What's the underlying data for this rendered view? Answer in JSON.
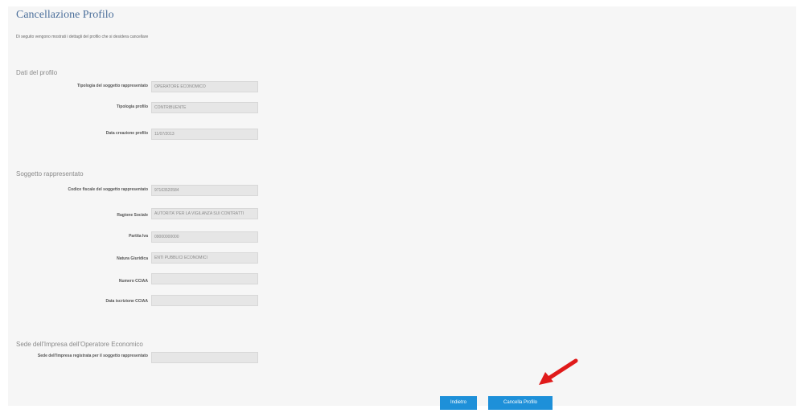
{
  "page": {
    "title": "Cancellazione Profilo",
    "intro": "Di seguito vengono mostrati i dettagli del profilo che si desidera cancellare"
  },
  "sections": [
    {
      "title": "Dati del profilo",
      "rows": [
        {
          "label": "Tipologia del soggetto rappresentato",
          "value": "OPERATORE ECONOMICO"
        },
        {
          "label": "Tipologia profilo",
          "value": "CONTRIBUENTE"
        },
        {
          "label": "Data creazione profilo",
          "value": "11/07/2013"
        }
      ]
    },
    {
      "title": "Soggetto rappresentato",
      "rows": [
        {
          "label": "Codice fiscale del soggetto rappresentato",
          "value": "97163520584"
        },
        {
          "label": "Ragione Sociale",
          "value": "AUTORITA' PER LA VIGILANZA SUI CONTRATTI"
        },
        {
          "label": "Partita Iva",
          "value": "09000000000"
        },
        {
          "label": "Natura Giuridica",
          "value": "ENTI PUBBLICI ECONOMICI"
        },
        {
          "label": "Numero CCIAA",
          "value": ""
        },
        {
          "label": "Data iscrizione CCIAA",
          "value": ""
        }
      ]
    },
    {
      "title": "Sede dell'Impresa dell'Operatore Economico",
      "rows": [
        {
          "label": "Sede dell'Impresa registrata per il soggetto rappresentato",
          "value": ""
        }
      ]
    }
  ],
  "buttons": {
    "back": "Indietro",
    "delete": "Cancella Profilo"
  },
  "colors": {
    "title": "#4a6e9a",
    "button": "#1e90d9",
    "arrow": "#e01a1a"
  }
}
